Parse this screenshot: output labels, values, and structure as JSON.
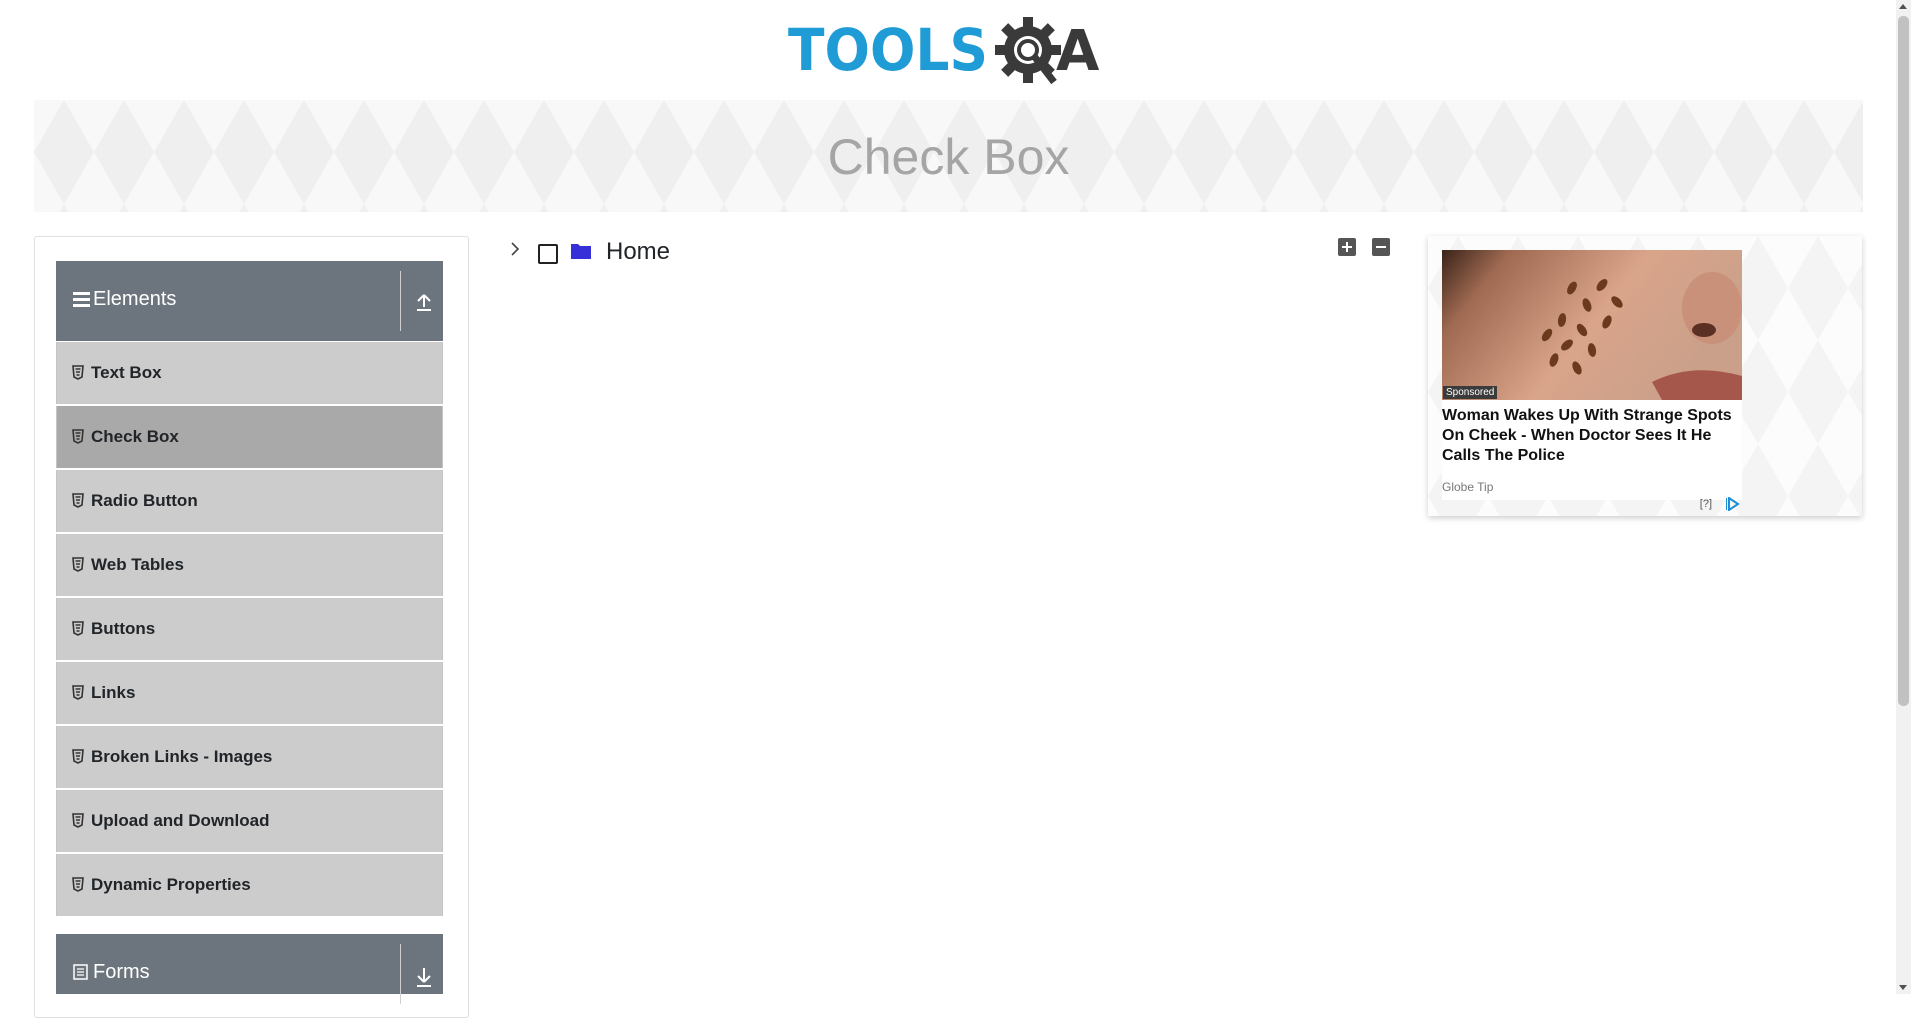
{
  "logo": {
    "text_left": "TOOLS",
    "text_right": "A",
    "colors": {
      "blue": "#1f9bd6",
      "dark": "#3a3a3a"
    }
  },
  "banner": {
    "title": "Check Box"
  },
  "sidebar": {
    "groups": [
      {
        "label": "Elements",
        "icon": "menu-icon",
        "toggle_icon": "collapse-up-icon",
        "items": [
          {
            "label": "Text Box",
            "active": false
          },
          {
            "label": "Check Box",
            "active": true
          },
          {
            "label": "Radio Button",
            "active": false
          },
          {
            "label": "Web Tables",
            "active": false
          },
          {
            "label": "Buttons",
            "active": false
          },
          {
            "label": "Links",
            "active": false
          },
          {
            "label": "Broken Links - Images",
            "active": false
          },
          {
            "label": "Upload and Download",
            "active": false
          },
          {
            "label": "Dynamic Properties",
            "active": false
          }
        ]
      },
      {
        "label": "Forms",
        "icon": "form-icon",
        "toggle_icon": "expand-down-icon"
      }
    ],
    "colors": {
      "header_bg": "#6c757d",
      "item_bg": "#cccccc",
      "active_bg": "#a9a9a9"
    }
  },
  "tree": {
    "root": {
      "label": "Home",
      "checked": false,
      "expanded": false
    },
    "expand_all_icon": "plus-square-icon",
    "collapse_all_icon": "minus-square-icon",
    "folder_color": "#3630d8"
  },
  "ad": {
    "badge": "Sponsored",
    "headline": "Woman Wakes Up With Strange Spots On Cheek - When Doctor Sees It He Calls The Police",
    "source": "Globe Tip",
    "info": "[?]",
    "choice_icon": "adchoices-icon"
  }
}
